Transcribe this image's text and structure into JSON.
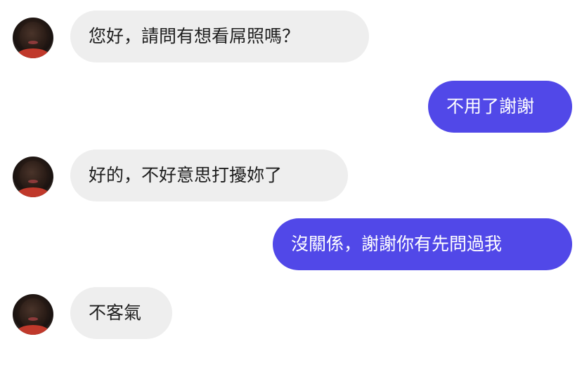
{
  "messages": [
    {
      "side": "in",
      "text": "您好，請問有想看屌照嗎？",
      "avatar": "person-avatar-icon"
    },
    {
      "side": "out",
      "text": "不用了謝謝"
    },
    {
      "side": "in",
      "text": "好的，不好意思打擾妳了",
      "avatar": "person-avatar-icon"
    },
    {
      "side": "out",
      "text": "沒關係，謝謝你有先問過我"
    },
    {
      "side": "in",
      "text": "不客氣",
      "avatar": "person-avatar-icon"
    }
  ],
  "colors": {
    "incoming_bubble": "#eeeeee",
    "outgoing_bubble": "#5148e8",
    "incoming_text": "#1e1e1e",
    "outgoing_text": "#ffffff"
  }
}
